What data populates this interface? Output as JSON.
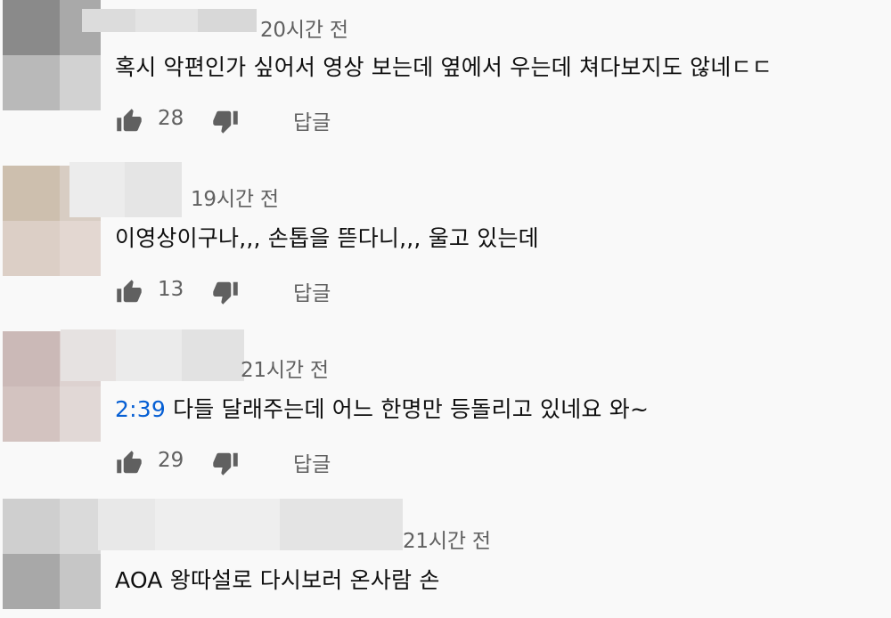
{
  "comments": [
    {
      "time": "20시간 전",
      "text": "혹시 악편인가 싶어서 영상 보는데 옆에서 우는데 쳐다보지도 않네ㄷㄷ",
      "likes": "28",
      "reply_label": "답글"
    },
    {
      "time": "19시간 전",
      "text": "이영상이구나,,, 손톱을 뜯다니,,, 울고 있는데",
      "likes": "13",
      "reply_label": "답글"
    },
    {
      "time": "21시간 전",
      "timestamp_link": "2:39",
      "text": " 다들 달래주는데 어느 한명만 등돌리고 있네요 와~",
      "likes": "29",
      "reply_label": "답글"
    },
    {
      "time": "21시간 전",
      "text": "AOA 왕따설로 다시보러 온사람 손"
    }
  ],
  "icons": {
    "like": "thumb-up-icon",
    "dislike": "thumb-down-icon"
  },
  "colors": {
    "background": "#f9f9f9",
    "text": "#0f0f0f",
    "secondary_text": "#606060",
    "link": "#065fd4",
    "icon": "#606060"
  }
}
